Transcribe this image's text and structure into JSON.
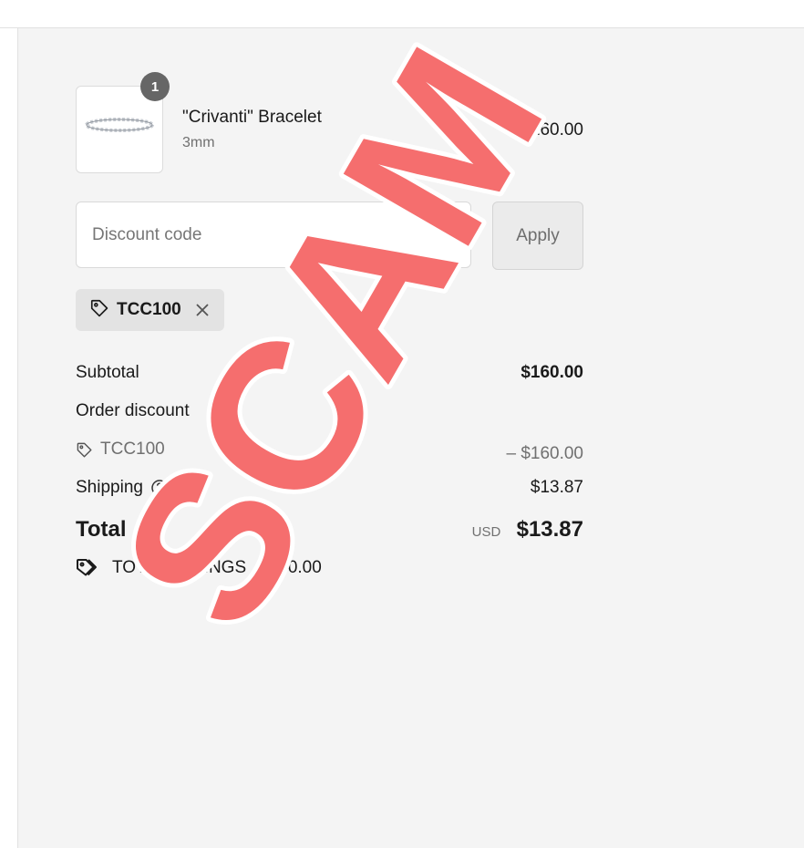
{
  "product": {
    "quantity": "1",
    "name": "\"Crivanti\" Bracelet",
    "variant": "3mm",
    "price": "$160.00"
  },
  "discount": {
    "placeholder": "Discount code",
    "apply_label": "Apply",
    "applied_code": "TCC100"
  },
  "summary": {
    "subtotal_label": "Subtotal",
    "subtotal_value": "$160.00",
    "order_discount_label": "Order discount",
    "discount_code": "TCC100",
    "discount_value": "– $160.00",
    "shipping_label": "Shipping",
    "shipping_value": "$13.87",
    "total_label": "Total",
    "currency": "USD",
    "total_value": "$13.87",
    "savings_label": "TOTAL SAVINGS",
    "savings_value": "$160.00"
  },
  "watermark": {
    "text": "SCAM",
    "color": "#f56e6e"
  },
  "icons": [
    "tag-icon",
    "close-icon",
    "help-circle-icon",
    "savings-tag-icon"
  ]
}
